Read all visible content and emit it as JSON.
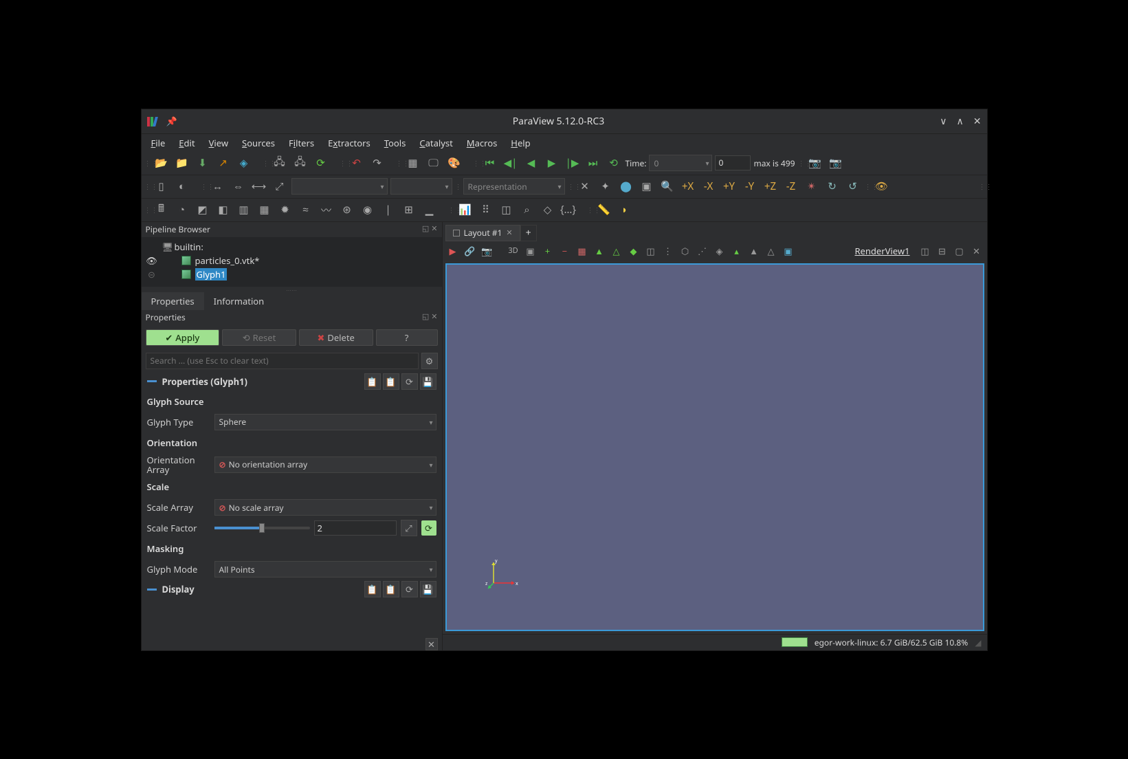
{
  "window": {
    "title": "ParaView 5.12.0-RC3"
  },
  "menubar": [
    "File",
    "Edit",
    "View",
    "Sources",
    "Filters",
    "Extractors",
    "Tools",
    "Catalyst",
    "Macros",
    "Help"
  ],
  "toolbar1": {
    "time_label": "Time:",
    "time_value": "0",
    "time_index": "0",
    "time_max": "max is 499"
  },
  "toolbar2": {
    "repr_placeholder": "Representation"
  },
  "pipeline": {
    "header": "Pipeline Browser",
    "items": [
      {
        "label": "builtin:",
        "icon": "server",
        "eye": false
      },
      {
        "label": "particles_0.vtk*",
        "icon": "cube",
        "eye": true
      },
      {
        "label": "Glyph1",
        "icon": "cube",
        "eye": false,
        "selected": true
      }
    ]
  },
  "proptabs": [
    "Properties",
    "Information"
  ],
  "propheader": "Properties",
  "buttons": {
    "apply": "Apply",
    "reset": "Reset",
    "delete": "Delete",
    "help": "?"
  },
  "search_placeholder": "Search ... (use Esc to clear text)",
  "sections": {
    "prop_title": "Properties (Glyph1)",
    "glyph_source_hdr": "Glyph Source",
    "glyph_type_lbl": "Glyph Type",
    "glyph_type_val": "Sphere",
    "orientation_hdr": "Orientation",
    "orient_array_lbl": "Orientation Array",
    "orient_array_val": "No orientation array",
    "scale_hdr": "Scale",
    "scale_array_lbl": "Scale Array",
    "scale_array_val": "No scale array",
    "scale_factor_lbl": "Scale Factor",
    "scale_factor_val": "2",
    "masking_hdr": "Masking",
    "glyph_mode_lbl": "Glyph Mode",
    "glyph_mode_val": "All Points",
    "display_title": "Display"
  },
  "layout": {
    "tab": "Layout #1",
    "add": "+"
  },
  "view": {
    "mode3d": "3D",
    "title": "RenderView1"
  },
  "status": {
    "text": "egor-work-linux: 6.7 GiB/62.5 GiB 10.8%"
  }
}
